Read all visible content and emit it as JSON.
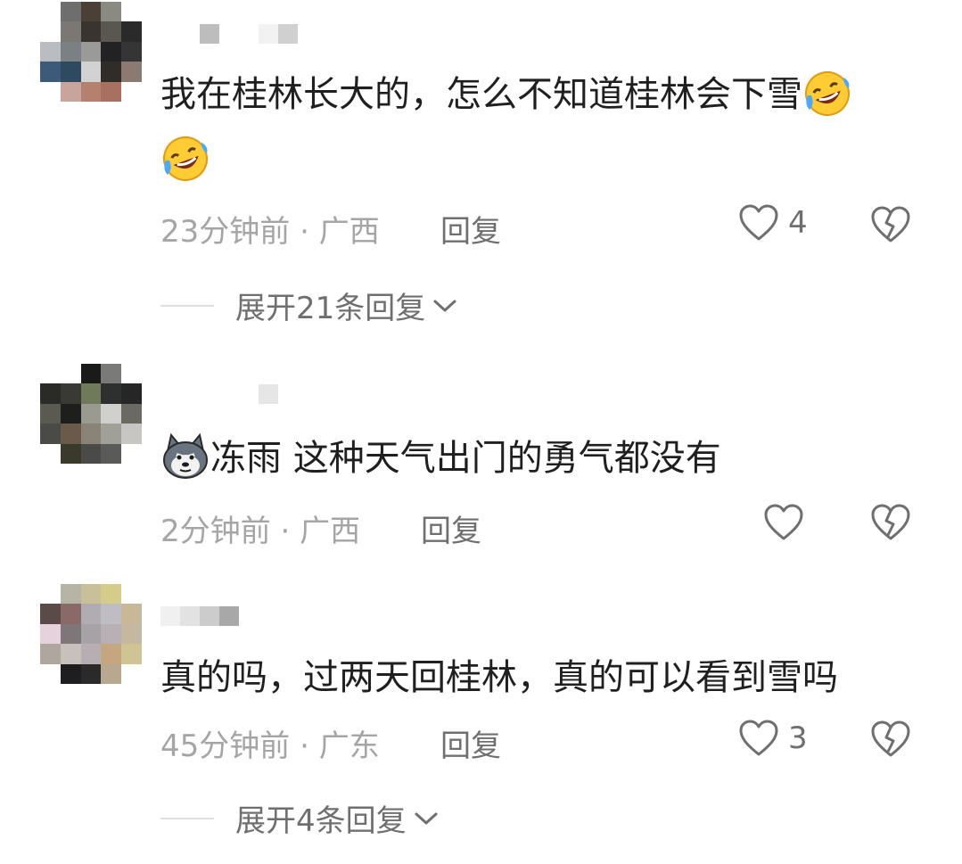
{
  "comments": [
    {
      "text": "我在桂林长大的，怎么不知道桂林会下雪",
      "emoji_icon": "rofl-emoji-icon",
      "time": "23分钟前",
      "location": "广西",
      "reply_label": "回复",
      "likes": "4",
      "expand_label": "展开21条回复"
    },
    {
      "text": "冻雨 这种天气出门的勇气都没有",
      "emoji_icon": "husky-dog-emoji-icon",
      "time": "2分钟前",
      "location": "广西",
      "reply_label": "回复",
      "likes": ""
    },
    {
      "text": "真的吗，过两天回桂林，真的可以看到雪吗",
      "time": "45分钟前",
      "location": "广东",
      "reply_label": "回复",
      "likes": "3",
      "expand_label": "展开4条回复"
    }
  ],
  "meta_separator": " · ",
  "colors": {
    "text": "#1f1f1f",
    "meta": "#a5a5a5",
    "action": "#6f6f6f"
  }
}
